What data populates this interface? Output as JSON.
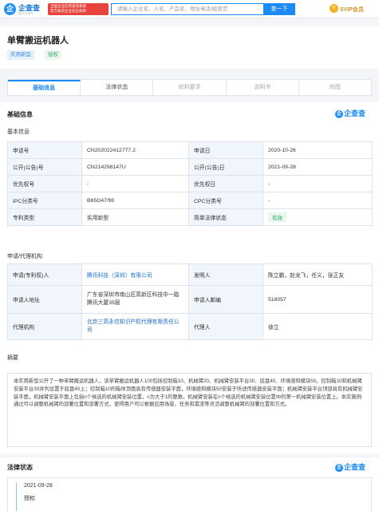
{
  "header": {
    "logo_mark": "企",
    "logo_text": "企查查",
    "logo_sub": "Qcc.com",
    "badge_line1": "全国企业信用查询系统",
    "badge_line2": "官方备案企业征信机构",
    "search_placeholder": "请输入企业名、人名、产品名、地址电话/经营范",
    "search_button": "查一下",
    "vip_label": "SVIP会员",
    "vip_icon": "V"
  },
  "title": {
    "name": "单臂搬运机器人",
    "tags": [
      "实用新型",
      "授权"
    ]
  },
  "tabs": [
    "基础信息",
    "法律状态",
    "权利要求",
    "说明书",
    "附图"
  ],
  "section_basic": "基础信息",
  "watermark": "企查查",
  "sub_basic": "基本信息",
  "basic_rows": [
    {
      "l1": "申请号",
      "v1": "CN202022412777.2",
      "l2": "申请日",
      "v2": "2020-10-26"
    },
    {
      "l1": "公开(公告)号",
      "v1": "CN214298147U",
      "l2": "公开(公告)日",
      "v2": "2021-09-28"
    },
    {
      "l1": "优先权号",
      "v1": "-",
      "l2": "优先权日",
      "v2": "-"
    },
    {
      "l1": "IPC分类号",
      "v1": "B65G47/90",
      "l2": "CPC分类号",
      "v2": "-"
    },
    {
      "l1": "专利类型",
      "v1": "实用新型",
      "l2": "简单法律状态",
      "v2": "有效"
    }
  ],
  "sub_agent": "申请/代理机构",
  "agent_rows": [
    {
      "l1": "申请(专利权)人",
      "v1": "腾讯科技（深圳）有限公司",
      "l2": "发明人",
      "v2": "陈立鹏，赵龙飞，任义，张正友"
    },
    {
      "l1": "申请人地址",
      "v1": "广东省深圳市南山区高新区科技中一路腾讯大厦35层",
      "l2": "申请人邮编",
      "v2": "518057"
    },
    {
      "l1": "代理机构",
      "v1": "北京三高永信知识产权代理有限责任公司",
      "l2": "代理人",
      "v2": "徐立"
    }
  ],
  "sub_abstract": "摘要",
  "abstract": "本实用新型公开了一种单臂搬运机器人，该单臂搬运机器人100包括控制箱10、机械臂20、机械臂安装平台30、底盘40、环境感知模块50。控制箱10和机械臂安装平台30并列设置于底盘40上；控制箱10的箱体顶面具有传感器安装平面，环境感知模块50安装于所述传感器安装平面；机械臂安装平台顶部具有机械臂安装平面，机械臂安装平面上包括n个候选的机械臂安装位置，n为大于1的整数，机械臂安装在n个候选的机械臂安装位置中的第一机械臂安装位置上。本实施例通过可以调整机械臂的部署位置和部署方式，使得用户可以根据应用场景、任务和需求等灵活调整机械臂的部署位置和方式。",
  "legal": {
    "title": "法律状态",
    "date": "2021-09-28",
    "status": "授权"
  },
  "colors": {
    "accent": "#1c8af5",
    "valid_green": "#2fa45f",
    "header_red": "#e8423c"
  }
}
